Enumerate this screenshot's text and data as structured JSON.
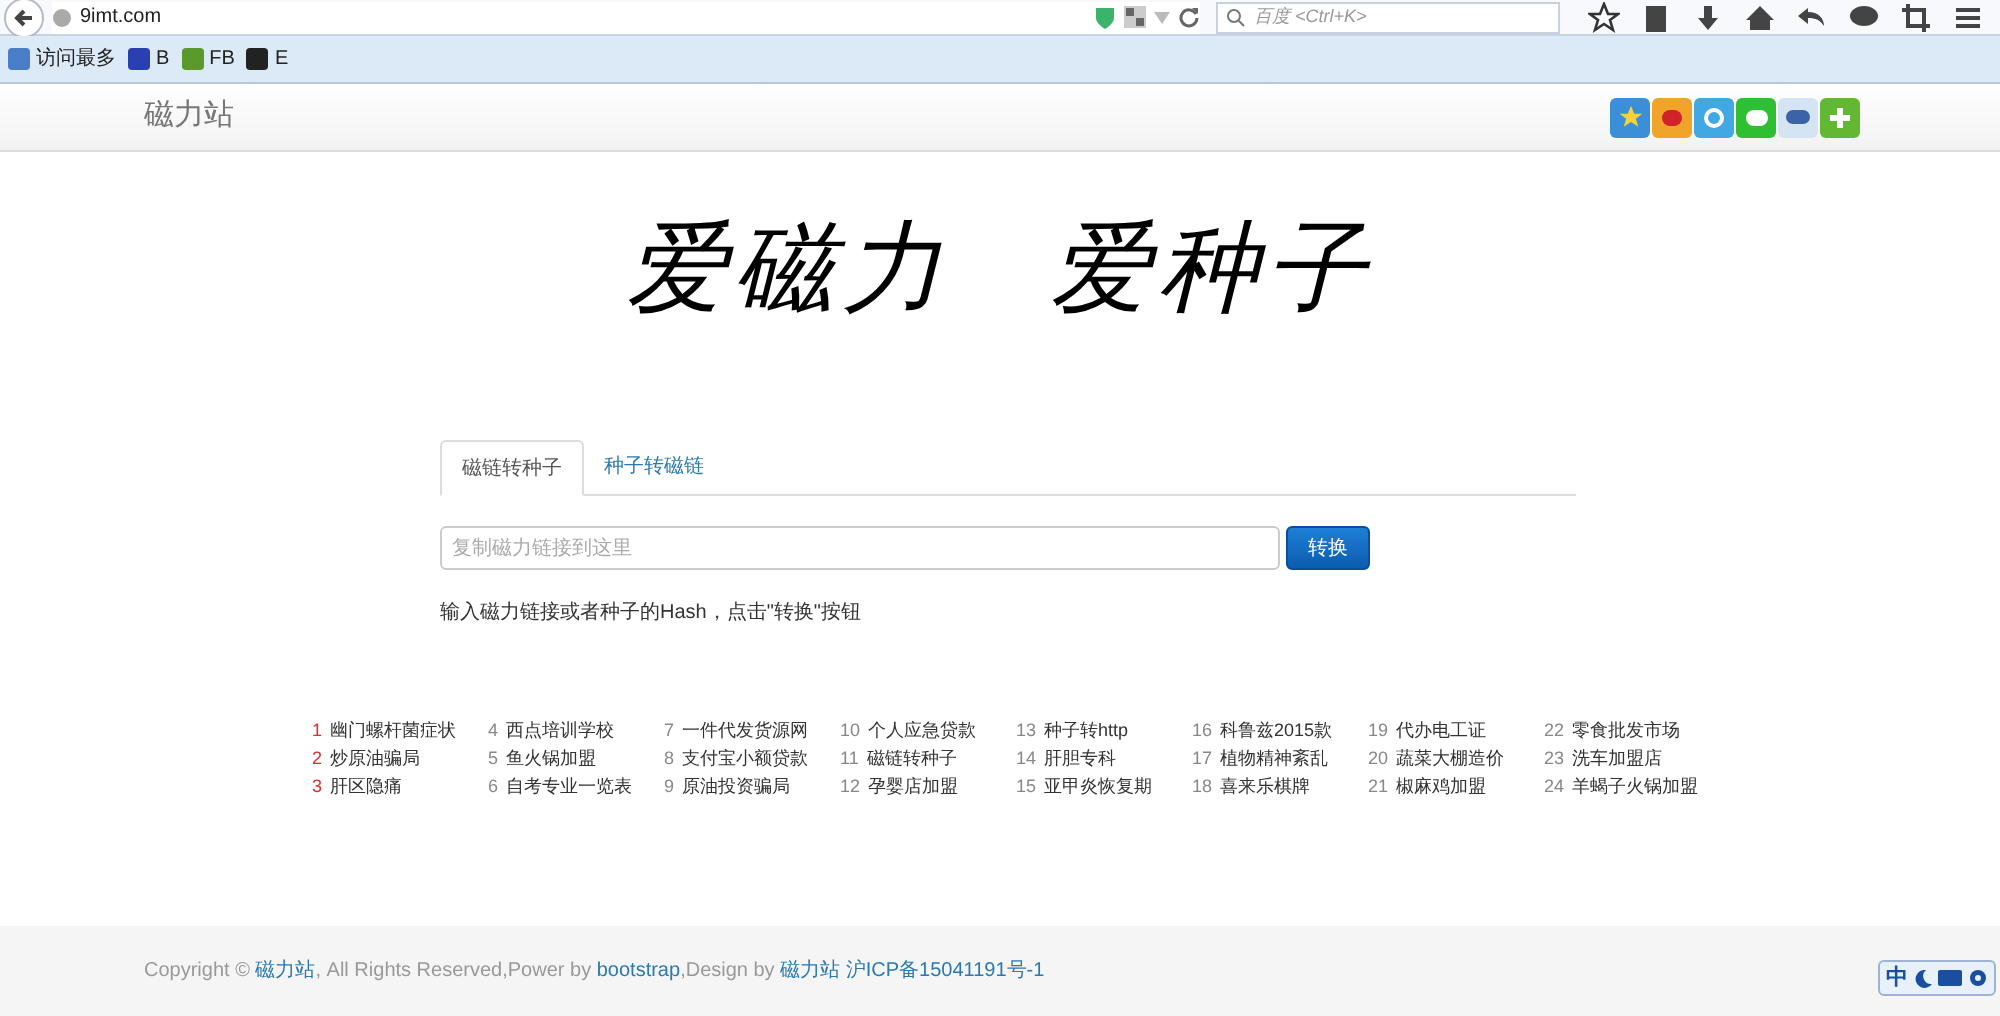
{
  "browser": {
    "url": "9imt.com",
    "search_placeholder": "百度 <Ctrl+K>",
    "bookmarks": [
      "访问最多",
      "B",
      "FB",
      "E"
    ]
  },
  "navbar": {
    "brand": "磁力站"
  },
  "hero": {
    "slogan": [
      "爱磁力",
      "爱种子"
    ]
  },
  "tabs": [
    {
      "label": "磁链转种子",
      "selected": true
    },
    {
      "label": "种子转磁链",
      "selected": false
    }
  ],
  "converter": {
    "placeholder": "复制磁力链接到这里",
    "button": "转换",
    "hint": "输入磁力链接或者种子的Hash，点击\"转换\"按钮"
  },
  "hot_links": [
    {
      "rank": "1",
      "label": "幽门螺杆菌症状",
      "hot": true
    },
    {
      "rank": "2",
      "label": "炒原油骗局",
      "hot": true
    },
    {
      "rank": "3",
      "label": "肝区隐痛",
      "hot": true
    },
    {
      "rank": "4",
      "label": "西点培训学校",
      "hot": false
    },
    {
      "rank": "5",
      "label": "鱼火锅加盟",
      "hot": false
    },
    {
      "rank": "6",
      "label": "自考专业一览表",
      "hot": false
    },
    {
      "rank": "7",
      "label": "一件代发货源网",
      "hot": false
    },
    {
      "rank": "8",
      "label": "支付宝小额贷款",
      "hot": false
    },
    {
      "rank": "9",
      "label": "原油投资骗局",
      "hot": false
    },
    {
      "rank": "10",
      "label": "个人应急贷款",
      "hot": false
    },
    {
      "rank": "11",
      "label": "磁链转种子",
      "hot": false
    },
    {
      "rank": "12",
      "label": "孕婴店加盟",
      "hot": false
    },
    {
      "rank": "13",
      "label": "种子转http",
      "hot": false
    },
    {
      "rank": "14",
      "label": "肝胆专科",
      "hot": false
    },
    {
      "rank": "15",
      "label": "亚甲炎恢复期",
      "hot": false
    },
    {
      "rank": "16",
      "label": "科鲁兹2015款",
      "hot": false
    },
    {
      "rank": "17",
      "label": "植物精神紊乱",
      "hot": false
    },
    {
      "rank": "18",
      "label": "喜来乐棋牌",
      "hot": false
    },
    {
      "rank": "19",
      "label": "代办电工证",
      "hot": false
    },
    {
      "rank": "20",
      "label": "蔬菜大棚造价",
      "hot": false
    },
    {
      "rank": "21",
      "label": "椒麻鸡加盟",
      "hot": false
    },
    {
      "rank": "22",
      "label": "零食批发市场",
      "hot": false
    },
    {
      "rank": "23",
      "label": "洗车加盟店",
      "hot": false
    },
    {
      "rank": "24",
      "label": "羊蝎子火锅加盟",
      "hot": false
    }
  ],
  "footer": [
    {
      "text": "Copyright © ",
      "link": false
    },
    {
      "text": "磁力站",
      "link": true
    },
    {
      "text": ", All Rights Reserved,Power by ",
      "link": false
    },
    {
      "text": "bootstrap",
      "link": true
    },
    {
      "text": ",Design by ",
      "link": false
    },
    {
      "text": "磁力站 沪ICP备15041191号-1",
      "link": true
    }
  ],
  "ime_bar": {
    "mode": "中"
  }
}
